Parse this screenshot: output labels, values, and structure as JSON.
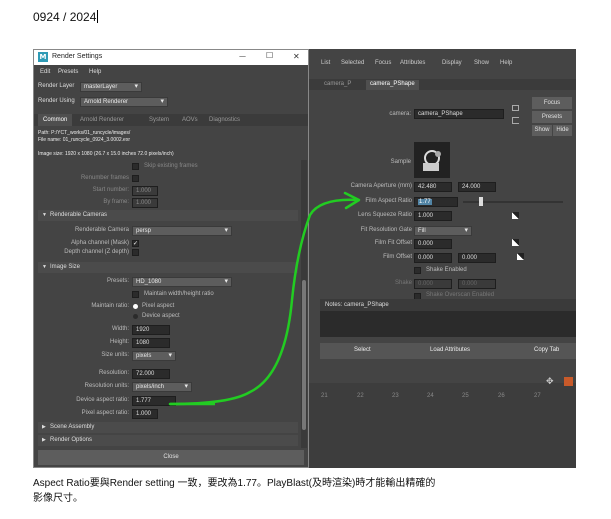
{
  "doc": {
    "date": "0924 / 2024",
    "caption_line1": "Aspect Ratio要與Render setting 一致，要改為1.77。PlayBlast(及時渲染)時才能輸出精確的",
    "caption_line2": "影像尺寸。"
  },
  "render_settings": {
    "logo": "M",
    "title": "Render Settings",
    "win_min": "—",
    "win_max": "☐",
    "win_close": "✕",
    "menu": [
      "Edit",
      "Presets",
      "Help"
    ],
    "render_layer_label": "Render Layer",
    "render_layer_value": "masterLayer",
    "render_using_label": "Render Using",
    "render_using_value": "Arnold Renderer",
    "tabs": [
      "Common",
      "Arnold Renderer",
      "System",
      "AOVs",
      "Diagnostics"
    ],
    "path_line": "Path: P:/YCT_works/01_runcycle/images/",
    "file_line": "File name: 01_runcycle_0924_3.0002.exr",
    "image_size_line": "Image size: 1920 x 1080 (26.7 x 15.0 inches 72.0 pixels/inch)",
    "skip_frames": "Skip existing frames",
    "renumber_frames": "Renumber frames",
    "start_number_label": "Start number:",
    "start_number": "1.000",
    "by_frame_label": "By frame:",
    "by_frame": "1.000",
    "renderable_cameras_section": "Renderable Cameras",
    "renderable_camera_label": "Renderable Camera",
    "renderable_camera_value": "persp",
    "alpha_label": "Alpha channel (Mask)",
    "alpha_check": "✓",
    "depth_label": "Depth channel (Z depth)",
    "image_size_section": "Image Size",
    "presets_label": "Presets:",
    "presets_value": "HD_1080",
    "maintain_wh": "Maintain width/height ratio",
    "maintain_ratio_label": "Maintain ratio:",
    "pixel_aspect": "Pixel aspect",
    "device_aspect": "Device aspect",
    "width_label": "Width:",
    "width": "1920",
    "height_label": "Height:",
    "height": "1080",
    "size_units_label": "Size units:",
    "size_units": "pixels",
    "resolution_label": "Resolution:",
    "resolution": "72.000",
    "resolution_units_label": "Resolution units:",
    "resolution_units": "pixels/inch",
    "device_aspect_label": "Device aspect ratio:",
    "device_aspect_ratio": "1.777",
    "pixel_aspect_label": "Pixel aspect ratio:",
    "pixel_aspect_ratio": "1.000",
    "scene_assembly_section": "Scene Assembly",
    "render_options_section": "Render Options",
    "close_button": "Close"
  },
  "attribute_editor": {
    "menu": [
      "List",
      "Selected",
      "Focus",
      "Attributes",
      "Display",
      "Show",
      "Help"
    ],
    "tabs": [
      "camera_P",
      "camera_PShape"
    ],
    "node_label": "camera:",
    "node_value": "camera_PShape",
    "focus_button": "Focus",
    "presets_button": "Presets",
    "show_button": "Show",
    "hide_button": "Hide",
    "sample_label": "Sample",
    "camera_aperture_label": "Camera Aperture (mm)",
    "camera_aperture_1": "42.480",
    "camera_aperture_2": "24.000",
    "film_aspect_label": "Film Aspect Ratio",
    "film_aspect_value": "1.77",
    "lens_squeeze_label": "Lens Squeeze Ratio",
    "lens_squeeze_value": "1.000",
    "fit_gate_label": "Fit Resolution Gate",
    "fit_gate_value": "Fill",
    "film_fit_offset_label": "Film Fit Offset",
    "film_fit_offset_value": "0.000",
    "film_offset_label": "Film Offset",
    "film_offset_1": "0.000",
    "film_offset_2": "0.000",
    "shake_enabled": "Shake Enabled",
    "shake_label": "Shake",
    "shake_1": "0.000",
    "shake_2": "0.000",
    "shake_overscan": "Shake Overscan Enabled",
    "notes_label": "Notes: camera_PShape",
    "select_button": "Select",
    "load_attributes_button": "Load Attributes",
    "copy_tab_button": "Copy Tab",
    "timeline_ticks": [
      "21",
      "22",
      "23",
      "24",
      "25",
      "26",
      "27"
    ]
  },
  "colors": {
    "annotation_green": "#22cc22",
    "highlight_blue": "#5285a6",
    "maya_panel": "#444444"
  }
}
